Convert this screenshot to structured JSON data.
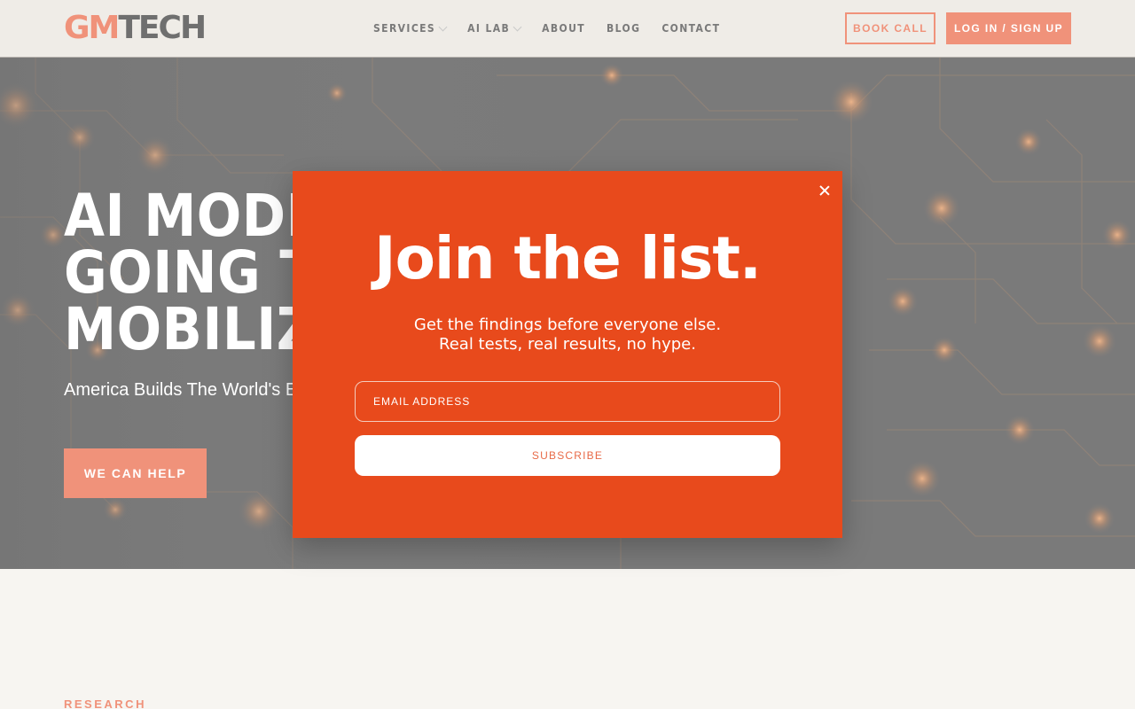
{
  "header": {
    "logo_gm": "GM",
    "logo_tech": "TECH",
    "nav": [
      {
        "label": "SERVICES",
        "has_dropdown": true
      },
      {
        "label": "AI LAB",
        "has_dropdown": true
      },
      {
        "label": "ABOUT",
        "has_dropdown": false
      },
      {
        "label": "BLOG",
        "has_dropdown": false
      },
      {
        "label": "CONTACT",
        "has_dropdown": false
      }
    ],
    "book_call_label": "BOOK CALL",
    "login_label": "LOG IN / SIGN UP"
  },
  "hero": {
    "title_lines": [
      "AI MODER",
      "GOING TO",
      "MOBILIZA"
    ],
    "subtitle": "America Builds The World's E",
    "cta_label": "WE CAN HELP"
  },
  "section": {
    "label": "RESEARCH"
  },
  "modal": {
    "title": "Join the list.",
    "subtitle_line1": "Get the findings before everyone else.",
    "subtitle_line2": "Real tests, real results, no hype.",
    "email_placeholder": "EMAIL ADDRESS",
    "subscribe_label": "SUBSCRIBE",
    "close_icon": "close-icon"
  },
  "colors": {
    "accent": "#f0927a",
    "modal_bg": "#e84a1c",
    "hero_bg": "#7b7b7b",
    "page_bg": "#f7f5f1"
  }
}
